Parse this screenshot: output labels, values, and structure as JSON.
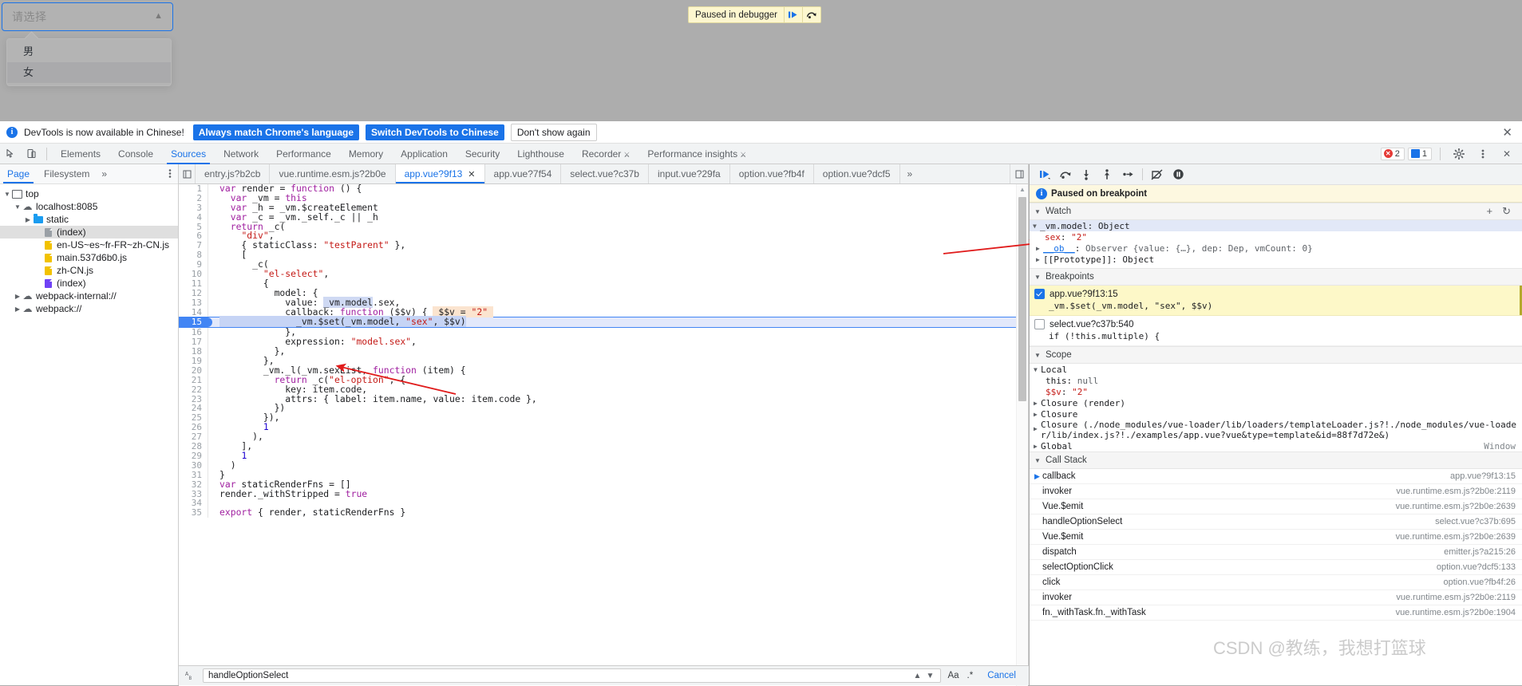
{
  "page": {
    "select": {
      "placeholder": "请选择",
      "arrow_icon": "chevron-up-icon",
      "options": [
        {
          "label": "男",
          "hovered": false
        },
        {
          "label": "女",
          "hovered": true
        }
      ]
    },
    "pause_bar": {
      "text": "Paused in debugger",
      "resume_icon": "resume-script-icon",
      "step_icon": "step-over-icon"
    }
  },
  "notification": {
    "icon": "info-icon",
    "text": "DevTools is now available in Chinese!",
    "primary_button": "Always match Chrome's language",
    "secondary_button": "Switch DevTools to Chinese",
    "dismiss_button": "Don't show again",
    "close_icon": "close-icon"
  },
  "devtools": {
    "left_icons": [
      "inspect-element-icon",
      "device-toolbar-icon"
    ],
    "tabs": [
      {
        "label": "Elements",
        "active": false
      },
      {
        "label": "Console",
        "active": false
      },
      {
        "label": "Sources",
        "active": true
      },
      {
        "label": "Network",
        "active": false
      },
      {
        "label": "Performance",
        "active": false
      },
      {
        "label": "Memory",
        "active": false
      },
      {
        "label": "Application",
        "active": false
      },
      {
        "label": "Security",
        "active": false
      },
      {
        "label": "Lighthouse",
        "active": false
      },
      {
        "label": "Recorder",
        "active": false,
        "badge": "experiment-icon"
      },
      {
        "label": "Performance insights",
        "active": false,
        "badge": "experiment-icon"
      }
    ],
    "error_count": "2",
    "message_count": "1",
    "settings_icon": "gear-icon",
    "more_icon": "kebab-menu-icon",
    "close_icon": "close-icon"
  },
  "navigator": {
    "tabs": [
      {
        "label": "Page",
        "active": true
      },
      {
        "label": "Filesystem",
        "active": false
      }
    ],
    "more_icon": "chevron-double-right-icon",
    "kebab_icon": "kebab-menu-icon",
    "tree": [
      {
        "label": "top",
        "indent": 0,
        "icon": "frame-icon",
        "twisty": "down",
        "selected": false
      },
      {
        "label": "localhost:8085",
        "indent": 1,
        "icon": "cloud-icon",
        "twisty": "down",
        "selected": false
      },
      {
        "label": "static",
        "indent": 2,
        "icon": "folder-icon",
        "twisty": "right",
        "selected": false
      },
      {
        "label": "(index)",
        "indent": 3,
        "icon": "document-gray-icon",
        "twisty": "none",
        "selected": true
      },
      {
        "label": "en-US~es~fr-FR~zh-CN.js",
        "indent": 3,
        "icon": "document-yellow-icon",
        "twisty": "none",
        "selected": false
      },
      {
        "label": "main.537d6b0.js",
        "indent": 3,
        "icon": "document-yellow-icon",
        "twisty": "none",
        "selected": false
      },
      {
        "label": "zh-CN.js",
        "indent": 3,
        "icon": "document-yellow-icon",
        "twisty": "none",
        "selected": false
      },
      {
        "label": "(index)",
        "indent": 3,
        "icon": "document-purple-icon",
        "twisty": "none",
        "selected": false
      },
      {
        "label": "webpack-internal://",
        "indent": 1,
        "icon": "cloud-icon",
        "twisty": "right",
        "selected": false
      },
      {
        "label": "webpack://",
        "indent": 1,
        "icon": "cloud-icon",
        "twisty": "right",
        "selected": false
      }
    ]
  },
  "editor": {
    "file_tabs": [
      {
        "label": "entry.js?b2cb",
        "active": false,
        "closable": false
      },
      {
        "label": "vue.runtime.esm.js?2b0e",
        "active": false,
        "closable": false
      },
      {
        "label": "app.vue?9f13",
        "active": true,
        "closable": true
      },
      {
        "label": "app.vue?7f54",
        "active": false,
        "closable": false
      },
      {
        "label": "select.vue?c37b",
        "active": false,
        "closable": false
      },
      {
        "label": "input.vue?29fa",
        "active": false,
        "closable": false
      },
      {
        "label": "option.vue?fb4f",
        "active": false,
        "closable": false
      },
      {
        "label": "option.vue?dcf5",
        "active": false,
        "closable": false
      }
    ],
    "more_tabs_icon": "chevron-double-right-icon",
    "execution_line": 15,
    "lines": [
      {
        "n": 1,
        "text": "var render = function () {"
      },
      {
        "n": 2,
        "text": "  var _vm = this"
      },
      {
        "n": 3,
        "text": "  var _h = _vm.$createElement"
      },
      {
        "n": 4,
        "text": "  var _c = _vm._self._c || _h"
      },
      {
        "n": 5,
        "text": "  return _c("
      },
      {
        "n": 6,
        "text": "    \"div\","
      },
      {
        "n": 7,
        "text": "    { staticClass: \"testParent\" },"
      },
      {
        "n": 8,
        "text": "    ["
      },
      {
        "n": 9,
        "text": "      _c("
      },
      {
        "n": 10,
        "text": "        \"el-select\","
      },
      {
        "n": 11,
        "text": "        {"
      },
      {
        "n": 12,
        "text": "          model: {"
      },
      {
        "n": 13,
        "text": "            value: _vm.model.sex,"
      },
      {
        "n": 14,
        "text": "            callback: function ($$v) {   $$v = \"2\""
      },
      {
        "n": 15,
        "text": "              _vm.$set(_vm.model, \"sex\", $$v)"
      },
      {
        "n": 16,
        "text": "            },"
      },
      {
        "n": 17,
        "text": "            expression: \"model.sex\","
      },
      {
        "n": 18,
        "text": "          },"
      },
      {
        "n": 19,
        "text": "        },"
      },
      {
        "n": 20,
        "text": "        _vm._l(_vm.sexList, function (item) {"
      },
      {
        "n": 21,
        "text": "          return _c(\"el-option\", {"
      },
      {
        "n": 22,
        "text": "            key: item.code,"
      },
      {
        "n": 23,
        "text": "            attrs: { label: item.name, value: item.code },"
      },
      {
        "n": 24,
        "text": "          })"
      },
      {
        "n": 25,
        "text": "        }),"
      },
      {
        "n": 26,
        "text": "        1"
      },
      {
        "n": 27,
        "text": "      ),"
      },
      {
        "n": 28,
        "text": "    ],"
      },
      {
        "n": 29,
        "text": "    1"
      },
      {
        "n": 30,
        "text": "  )"
      },
      {
        "n": 31,
        "text": "}"
      },
      {
        "n": 32,
        "text": "var staticRenderFns = []"
      },
      {
        "n": 33,
        "text": "render._withStripped = true"
      },
      {
        "n": 34,
        "text": ""
      },
      {
        "n": 35,
        "text": "export { render, staticRenderFns }"
      }
    ],
    "inline_eval": "$$v = \"2\""
  },
  "debugger": {
    "toolbar": [
      {
        "icon": "resume-script-icon",
        "name": "resume"
      },
      {
        "icon": "step-over-icon",
        "name": "step-over"
      },
      {
        "icon": "step-into-icon",
        "name": "step-into"
      },
      {
        "icon": "step-out-icon",
        "name": "step-out"
      },
      {
        "icon": "step-icon",
        "name": "step"
      },
      {
        "icon": "deactivate-breakpoints-icon",
        "name": "deactivate-breakpoints"
      },
      {
        "icon": "pause-on-exceptions-icon",
        "name": "pause-on-exceptions"
      }
    ],
    "paused_banner": "Paused on breakpoint",
    "watch": {
      "title": "Watch",
      "add_icon": "plus-icon",
      "refresh_icon": "refresh-icon",
      "entries": [
        {
          "indent": 0,
          "twisty": "down",
          "name": "_vm.model",
          "sep": ": ",
          "value": "Object",
          "style": "plain",
          "selected": true
        },
        {
          "indent": 1,
          "twisty": "none",
          "name": "sex",
          "sep": ": ",
          "value": "\"2\"",
          "style": "string",
          "selected": false
        },
        {
          "indent": 1,
          "twisty": "right",
          "name": "__ob__",
          "sep": ": ",
          "value": "Observer {value: {…}, dep: Dep, vmCount: 0}",
          "style": "gray",
          "selected": false
        },
        {
          "indent": 1,
          "twisty": "right",
          "name": "[[Prototype]]",
          "sep": ": ",
          "value": "Object",
          "style": "plain",
          "selected": false
        }
      ]
    },
    "breakpoints": {
      "title": "Breakpoints",
      "items": [
        {
          "checked": true,
          "location": "app.vue?9f13:15",
          "snippet": "_vm.$set(_vm.model, \"sex\", $$v)",
          "active": true
        },
        {
          "checked": false,
          "location": "select.vue?c37b:540",
          "snippet": "if (!this.multiple) {",
          "active": false
        }
      ]
    },
    "scope": {
      "title": "Scope",
      "entries": [
        {
          "indent": 0,
          "twisty": "down",
          "label": "Local",
          "value": "",
          "right": ""
        },
        {
          "indent": 1,
          "twisty": "none",
          "label": "this",
          "value": "null",
          "style": "gray",
          "right": ""
        },
        {
          "indent": 1,
          "twisty": "none",
          "label": "$$v",
          "value": "\"2\"",
          "style": "string",
          "right": ""
        },
        {
          "indent": 0,
          "twisty": "right",
          "label": "Closure (render)",
          "value": "",
          "right": ""
        },
        {
          "indent": 0,
          "twisty": "right",
          "label": "Closure",
          "value": "",
          "right": ""
        },
        {
          "indent": 0,
          "twisty": "right",
          "label": "Closure (./node_modules/vue-loader/lib/loaders/templateLoader.js?!./node_modules/vue-loader/lib/index.js?!./examples/app.vue?vue&type=template&id=88f7d72e&)",
          "value": "",
          "right": "",
          "wrap": true
        },
        {
          "indent": 0,
          "twisty": "right",
          "label": "Global",
          "value": "",
          "right": "Window"
        }
      ]
    },
    "call_stack": {
      "title": "Call Stack",
      "frames": [
        {
          "fn": "callback",
          "loc": "app.vue?9f13:15",
          "current": true
        },
        {
          "fn": "invoker",
          "loc": "vue.runtime.esm.js?2b0e:2119",
          "current": false
        },
        {
          "fn": "Vue.$emit",
          "loc": "vue.runtime.esm.js?2b0e:2639",
          "current": false
        },
        {
          "fn": "handleOptionSelect",
          "loc": "select.vue?c37b:695",
          "current": false
        },
        {
          "fn": "Vue.$emit",
          "loc": "vue.runtime.esm.js?2b0e:2639",
          "current": false
        },
        {
          "fn": "dispatch",
          "loc": "emitter.js?a215:26",
          "current": false
        },
        {
          "fn": "selectOptionClick",
          "loc": "option.vue?dcf5:133",
          "current": false
        },
        {
          "fn": "click",
          "loc": "option.vue?fb4f:26",
          "current": false
        },
        {
          "fn": "invoker",
          "loc": "vue.runtime.esm.js?2b0e:2119",
          "current": false
        },
        {
          "fn": "fn._withTask.fn._withTask",
          "loc": "vue.runtime.esm.js?2b0e:1904",
          "current": false
        }
      ]
    }
  },
  "search": {
    "icon": "text-search-icon",
    "value": "handleOptionSelect",
    "prev_icon": "chevron-up-icon",
    "next_icon": "chevron-down-icon",
    "match_case_label": "Aa",
    "regex_label": ".*",
    "cancel_label": "Cancel"
  },
  "watermark": "CSDN @教练，我想打篮球"
}
